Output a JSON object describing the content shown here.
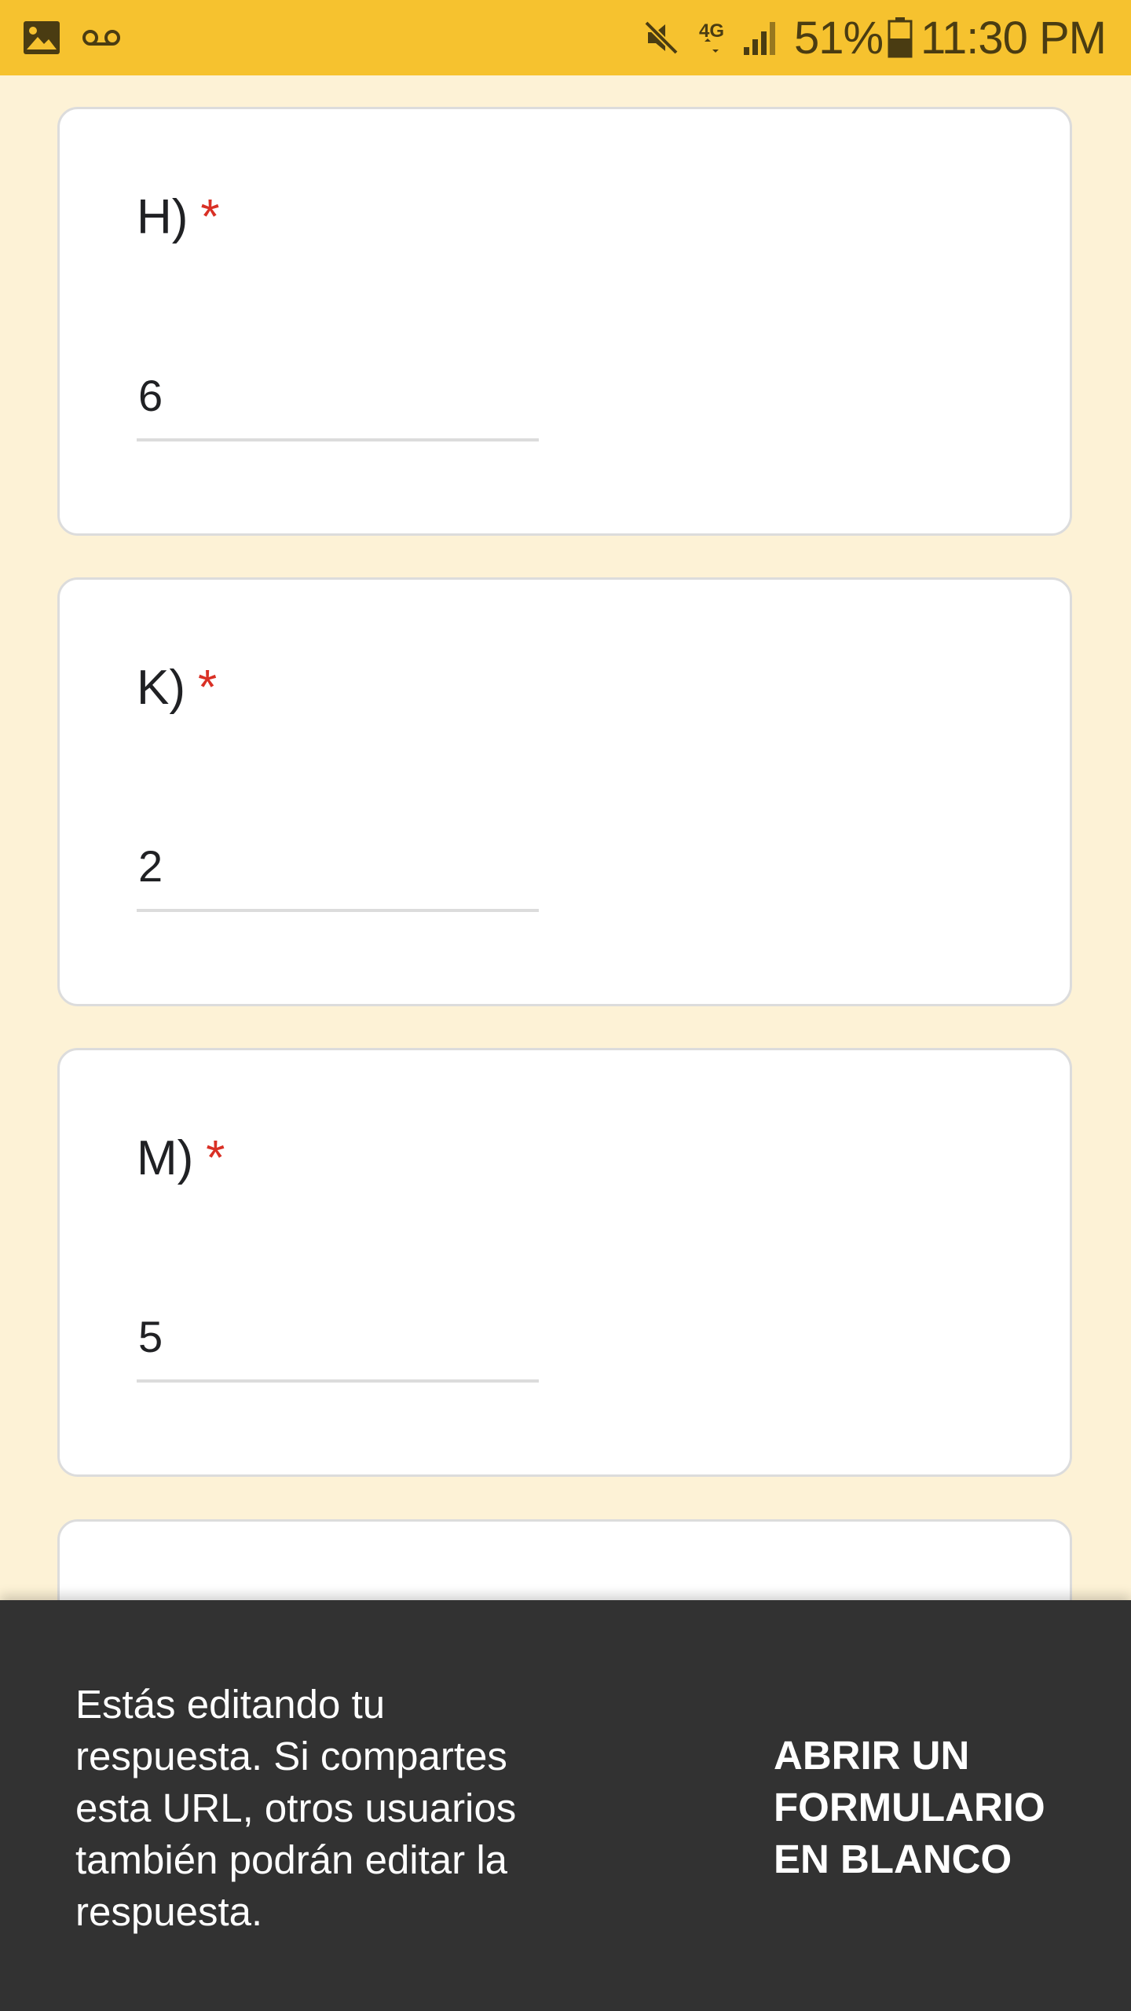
{
  "status_bar": {
    "left_icons": [
      "image-icon",
      "voicemail-icon"
    ],
    "right_icons": [
      "mute-icon",
      "4g-icon",
      "signal-icon",
      "battery-icon"
    ],
    "network": "4G",
    "battery": "51%",
    "time": "11:30 PM",
    "background_color": "#f6c22f"
  },
  "questions": [
    {
      "label": "H)",
      "required": "*",
      "answer": "6"
    },
    {
      "label": "K)",
      "required": "*",
      "answer": "2"
    },
    {
      "label": "M)",
      "required": "*",
      "answer": "5"
    }
  ],
  "snackbar": {
    "message": "Estás editando tu respuesta. Si compartes esta URL, otros usuarios también podrán editar la respuesta.",
    "action": "ABRIR UN FORMULARIO EN BLANCO"
  },
  "colors": {
    "page_background": "#fdf2d6",
    "required_asterisk": "#d93025",
    "snackbar_background": "#323232"
  }
}
